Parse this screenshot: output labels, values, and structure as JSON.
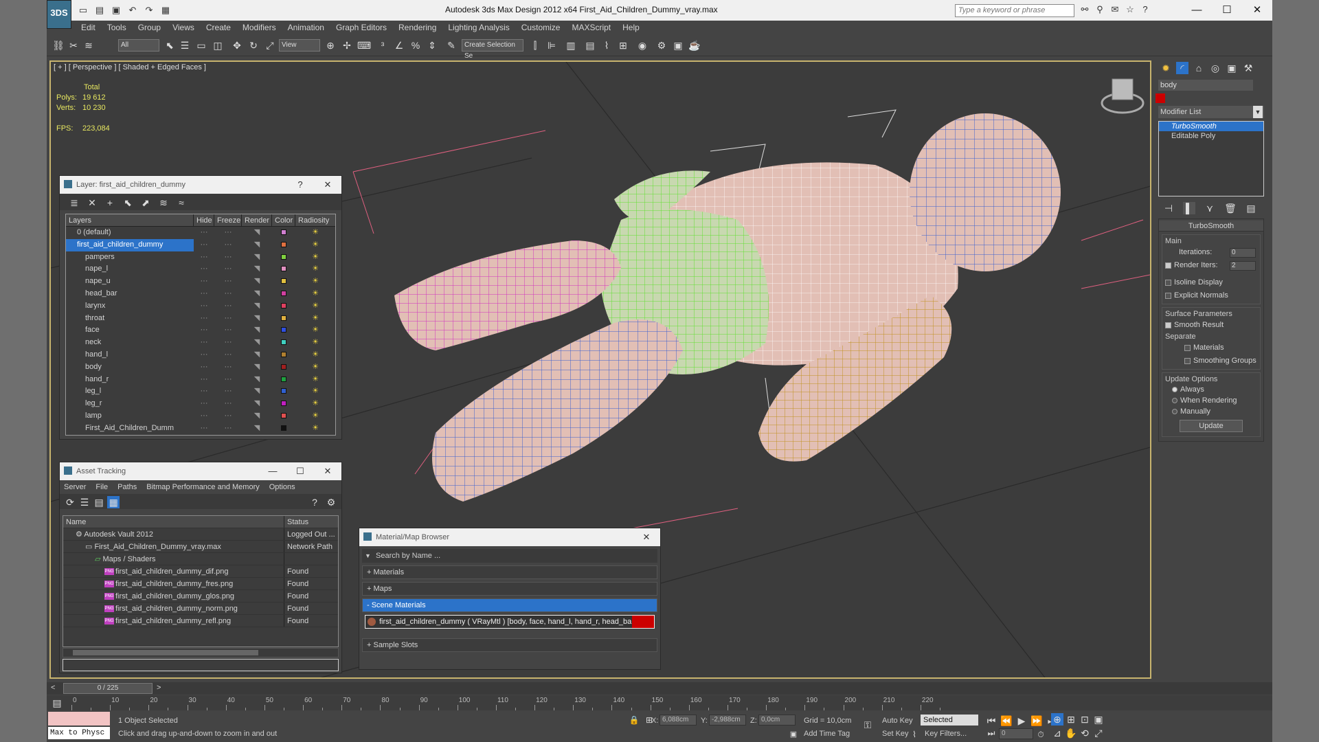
{
  "app": {
    "logo_text": "3DS",
    "title": "Autodesk 3ds Max Design 2012 x64      First_Aid_Children_Dummy_vray.max",
    "search_placeholder": "Type a keyword or phrase"
  },
  "menu": [
    "Edit",
    "Tools",
    "Group",
    "Views",
    "Create",
    "Modifiers",
    "Animation",
    "Graph Editors",
    "Rendering",
    "Lighting Analysis",
    "Customize",
    "MAXScript",
    "Help"
  ],
  "toolbar": {
    "filter_value": "All",
    "ref_coord_value": "View",
    "selection_set_placeholder": "Create Selection Se"
  },
  "viewport": {
    "label": "[ + ] [ Perspective ] [ Shaded + Edged Faces ]",
    "stats_total": "Total",
    "polys_label": "Polys:",
    "polys_value": "19 612",
    "verts_label": "Verts:",
    "verts_value": "10 230",
    "fps_label": "FPS:",
    "fps_value": "223,084"
  },
  "layer_window": {
    "title": "Layer: first_aid_children_dummy",
    "columns": [
      "Layers",
      "Hide",
      "Freeze",
      "Render",
      "Color",
      "Radiosity"
    ],
    "rows": [
      {
        "name": "0 (default)",
        "color": "#d080d0",
        "level": 0
      },
      {
        "name": "first_aid_children_dummy",
        "color": "#e07040",
        "level": 0
      },
      {
        "name": "pampers",
        "color": "#80d040",
        "level": 1
      },
      {
        "name": "nape_l",
        "color": "#e090c0",
        "level": 1
      },
      {
        "name": "nape_u",
        "color": "#e0c040",
        "level": 1
      },
      {
        "name": "head_bar",
        "color": "#d040a0",
        "level": 1
      },
      {
        "name": "larynx",
        "color": "#e04060",
        "level": 1
      },
      {
        "name": "throat",
        "color": "#e0b040",
        "level": 1
      },
      {
        "name": "face",
        "color": "#3050e0",
        "level": 1
      },
      {
        "name": "neck",
        "color": "#40d0c0",
        "level": 1
      },
      {
        "name": "hand_l",
        "color": "#b08030",
        "level": 1
      },
      {
        "name": "body",
        "color": "#a02020",
        "level": 1
      },
      {
        "name": "hand_r",
        "color": "#20a040",
        "level": 1
      },
      {
        "name": "leg_l",
        "color": "#3060d0",
        "level": 1
      },
      {
        "name": "leg_r",
        "color": "#c020c0",
        "level": 1
      },
      {
        "name": "lamp",
        "color": "#e05050",
        "level": 1
      },
      {
        "name": "First_Aid_Children_Dumm",
        "color": "#111111",
        "level": 1
      }
    ]
  },
  "asset_window": {
    "title": "Asset Tracking",
    "menu": [
      "Server",
      "File",
      "Paths",
      "Bitmap Performance and Memory",
      "Options"
    ],
    "columns": [
      "Name",
      "Status"
    ],
    "rows": [
      {
        "name": "Autodesk Vault 2012",
        "status": "Logged Out ...",
        "level": 0,
        "icon": "vault"
      },
      {
        "name": "First_Aid_Children_Dummy_vray.max",
        "status": "Network Path",
        "level": 1,
        "icon": "file"
      },
      {
        "name": "Maps / Shaders",
        "status": "",
        "level": 2,
        "icon": "maps"
      },
      {
        "name": "first_aid_children_dummy_dif.png",
        "status": "Found",
        "level": 3,
        "icon": "png"
      },
      {
        "name": "first_aid_children_dummy_fres.png",
        "status": "Found",
        "level": 3,
        "icon": "png"
      },
      {
        "name": "first_aid_children_dummy_glos.png",
        "status": "Found",
        "level": 3,
        "icon": "png"
      },
      {
        "name": "first_aid_children_dummy_norm.png",
        "status": "Found",
        "level": 3,
        "icon": "png"
      },
      {
        "name": "first_aid_children_dummy_refl.png",
        "status": "Found",
        "level": 3,
        "icon": "png"
      }
    ]
  },
  "material_browser": {
    "title": "Material/Map Browser",
    "search_placeholder": "Search by Name ...",
    "sections": [
      "+ Materials",
      "+ Maps",
      "- Scene Materials"
    ],
    "scene_material": "first_aid_children_dummy  ( VRayMtl )  [body, face, hand_l, hand_r, head_bar, la...",
    "sample_slots": "+ Sample Slots"
  },
  "command_panel": {
    "object_name": "body",
    "modifier_list": "Modifier List",
    "stack": [
      "TurboSmooth",
      "Editable Poly"
    ],
    "rollout_title": "TurboSmooth",
    "main_label": "Main",
    "iterations_label": "Iterations:",
    "iterations_value": "0",
    "render_iters_label": "Render Iters:",
    "render_iters_value": "2",
    "isoline_label": "Isoline Display",
    "explicit_normals_label": "Explicit Normals",
    "surface_params_label": "Surface Parameters",
    "smooth_result_label": "Smooth Result",
    "separate_label": "Separate",
    "materials_label": "Materials",
    "smoothing_groups_label": "Smoothing Groups",
    "update_options_label": "Update Options",
    "always_label": "Always",
    "when_rendering_label": "When Rendering",
    "manually_label": "Manually",
    "update_button": "Update"
  },
  "timeline": {
    "frame_readout": "0 / 225",
    "ticks": [
      "0",
      "10",
      "20",
      "30",
      "40",
      "50",
      "60",
      "70",
      "80",
      "90",
      "100",
      "110",
      "120",
      "130",
      "140",
      "150",
      "160",
      "170",
      "180",
      "190",
      "200",
      "210",
      "220"
    ]
  },
  "status": {
    "maxscript_label": "Max to Physc",
    "selected_text": "1 Object Selected",
    "prompt_text": "Click and drag up-and-down to zoom in and out",
    "x_label": "X:",
    "x_value": "6,088cm",
    "y_label": "Y:",
    "y_value": "-2,988cm",
    "z_label": "Z:",
    "z_value": "0,0cm",
    "grid_text": "Grid = 10,0cm",
    "add_time_tag": "Add Time Tag",
    "auto_key": "Auto Key",
    "set_key": "Set Key",
    "selected_dropdown": "Selected",
    "key_filters": "Key Filters...",
    "frame_value": "0"
  }
}
